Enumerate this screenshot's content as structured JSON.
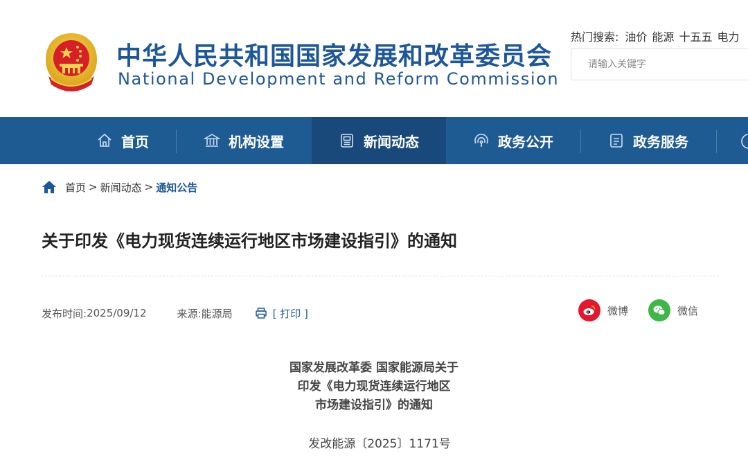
{
  "site": {
    "title_cn": "中华人民共和国国家发展和改革委员会",
    "title_en": "National Development and Reform Commission"
  },
  "hot_search": {
    "label": "热门搜索:",
    "keywords": [
      "油价",
      "能源",
      "十五五",
      "电力"
    ]
  },
  "search": {
    "placeholder": "请输入关键字"
  },
  "nav": {
    "items": [
      {
        "label": "首页",
        "icon": "home-icon"
      },
      {
        "label": "机构设置",
        "icon": "institution-icon"
      },
      {
        "label": "新闻动态",
        "icon": "news-icon"
      },
      {
        "label": "政务公开",
        "icon": "broadcast-icon"
      },
      {
        "label": "政务服务",
        "icon": "service-icon"
      }
    ],
    "active": "新闻动态"
  },
  "breadcrumb": {
    "home": "首页",
    "sep": ">",
    "news": "新闻动态",
    "current": "通知公告"
  },
  "article": {
    "title": "关于印发《电力现货连续运行地区市场建设指引》的通知",
    "publish_label": "发布时间:",
    "publish_date": "2025/09/12",
    "source_label": "来源:",
    "source": "能源局",
    "print_label": "[ 打印 ]",
    "heading_lines": [
      "国家发展改革委 国家能源局关于",
      "印发《电力现货连续运行地区",
      "市场建设指引》的通知"
    ],
    "doc_number": "发改能源〔2025〕1171号"
  },
  "share": {
    "weibo": "微博",
    "wechat": "微信"
  },
  "colors": {
    "brand_blue": "#1e5799",
    "nav_bg": "#1f5b93",
    "nav_active": "#18497a",
    "weibo_red": "#e6162d",
    "wechat_green": "#3db846"
  }
}
